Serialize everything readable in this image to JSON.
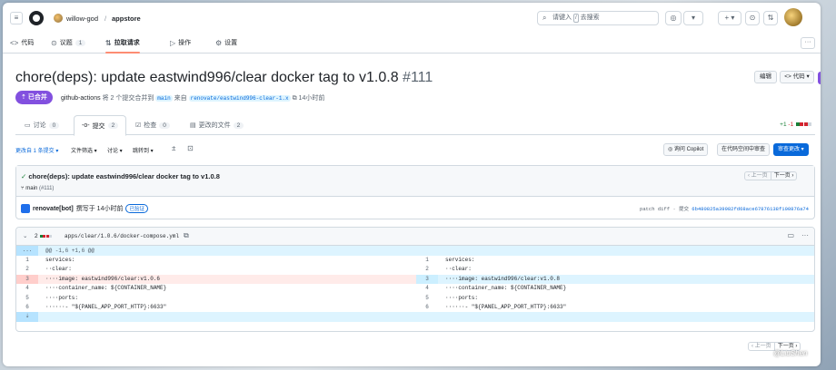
{
  "header": {
    "owner": "willow-god",
    "separator": "/",
    "repo": "appstore",
    "search_placeholder_prefix": "请键入",
    "search_key": "/",
    "search_placeholder_suffix": "去搜索"
  },
  "repo_nav": {
    "items": [
      {
        "icon": "<>",
        "label": "代码"
      },
      {
        "icon": "⊙",
        "label": "议题",
        "count": "1"
      },
      {
        "icon": "⇅",
        "label": "拉取请求"
      },
      {
        "icon": "▷",
        "label": "操作"
      },
      {
        "icon": "⚙",
        "label": "设置"
      }
    ]
  },
  "pr": {
    "title": "chore(deps): update eastwind996/clear docker tag to v1.0.8",
    "number": "#111",
    "state": "已合并",
    "author": "github-actions",
    "meta_text_1": "将 2 个提交合并到",
    "base_branch": "main",
    "meta_text_2": "来自",
    "head_branch": "renovate/eastwind996-clear-1.x",
    "time": "14小时前",
    "edit_label": "编辑",
    "code_label": "代码"
  },
  "tabs": [
    {
      "label": "讨论",
      "count": "0"
    },
    {
      "label": "提交",
      "count": "2"
    },
    {
      "label": "检查",
      "count": "0"
    },
    {
      "label": "更改的文件",
      "count": "2"
    }
  ],
  "diffstat": {
    "additions": "+1",
    "deletions": "-1"
  },
  "toolbar": {
    "changes_from": "更改自 1 条提交",
    "file_filter": "文件筛选",
    "discussion": "讨论",
    "jump_to": "跳转到",
    "copilot": "询问 Copilot",
    "open_workspace": "在代码空间中审查",
    "review": "审查更改"
  },
  "commit": {
    "title": "chore(deps): update eastwind996/clear docker tag to v1.0.8",
    "branch": "main",
    "pr_ref": "(#111)",
    "author": "renovate[bot]",
    "authored": "撰写于 14小时前",
    "verified": "已验证",
    "patch_label": "patch diff",
    "commit_label": "提交",
    "sha": "6b480825a39982fd68ace67876138f100876a74",
    "prev": "上一页",
    "next": "下一页"
  },
  "diff": {
    "count": "2",
    "path": "apps/clear/1.0.6/docker-compose.yml",
    "hunk": "@@ -1,6 +1,6 @@",
    "expand": "...",
    "left": [
      {
        "ln": "1",
        "code": "services:"
      },
      {
        "ln": "2",
        "code": "··clear:"
      },
      {
        "ln": "3",
        "code": "····image: eastwind996/clear:v1.0.6"
      },
      {
        "ln": "4",
        "code": "····container_name: ${CONTAINER_NAME}"
      },
      {
        "ln": "5",
        "code": "····ports:"
      },
      {
        "ln": "6",
        "code": "······- \"${PANEL_APP_PORT_HTTP}:6633\""
      }
    ],
    "right": [
      {
        "ln": "1",
        "code": "services:"
      },
      {
        "ln": "2",
        "code": "··clear:"
      },
      {
        "ln": "3",
        "code": "····image: eastwind996/clear:v1.0.8"
      },
      {
        "ln": "4",
        "code": "····container_name: ${CONTAINER_NAME}"
      },
      {
        "ln": "5",
        "code": "····ports:"
      },
      {
        "ln": "6",
        "code": "······- \"${PANEL_APP_PORT_HTTP}:6633\""
      }
    ]
  },
  "watermark": "@LiuShen",
  "colors": {
    "merged": "#8250df",
    "primary": "#0969da",
    "deleted_line": "#ffebe9",
    "added_line": "#ddf4ff",
    "active_tab_underline": "#fd8c73"
  }
}
